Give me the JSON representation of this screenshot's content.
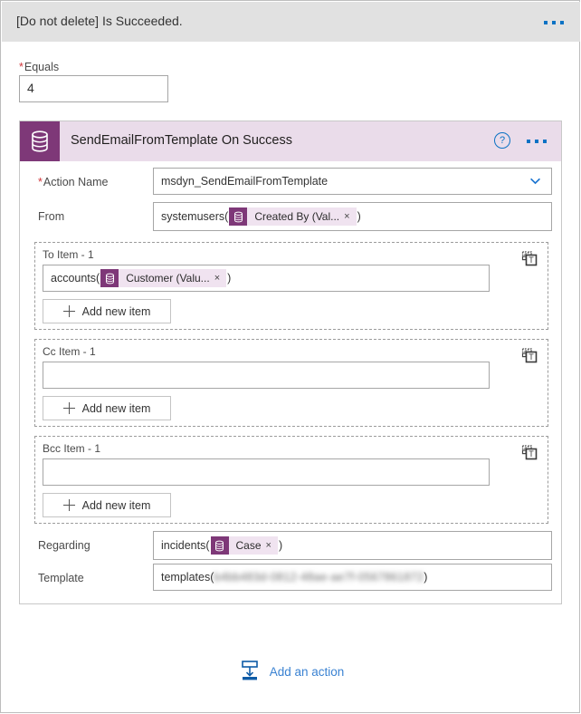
{
  "titlebar": {
    "title": "[Do not delete] Is Succeeded.",
    "more_menu": "…"
  },
  "condition": {
    "equals_label": "Equals",
    "equals_required": "*",
    "equals_value": "4"
  },
  "card": {
    "icon": "database-icon",
    "title": "SendEmailFromTemplate On Success",
    "help_icon": "?",
    "more_menu": "…",
    "action_name": {
      "label": "Action Name",
      "required": "*",
      "value": "msdyn_SendEmailFromTemplate",
      "chevron": "chevron-down-icon"
    },
    "from": {
      "label": "From",
      "prefix": "systemusers(",
      "chip_text": "Created By (Val...",
      "chip_close": "×",
      "suffix": ")"
    },
    "to_group": {
      "label": "To Item - 1",
      "prefix": "accounts(",
      "chip_text": "Customer (Valu...",
      "chip_close": "×",
      "suffix": ")",
      "add_new": "Add new item",
      "delete_icon": "delete-item-icon"
    },
    "cc_group": {
      "label": "Cc Item - 1",
      "value": "",
      "add_new": "Add new item",
      "delete_icon": "delete-item-icon"
    },
    "bcc_group": {
      "label": "Bcc Item - 1",
      "value": "",
      "add_new": "Add new item",
      "delete_icon": "delete-item-icon"
    },
    "regarding": {
      "label": "Regarding",
      "prefix": "incidents(",
      "chip_text": "Case",
      "chip_close": "×",
      "suffix": ")"
    },
    "template": {
      "label": "Template",
      "prefix": "templates(",
      "value_redacted": "b4bb483d-0812-48ae-ae7f-0567861872",
      "suffix": ")"
    }
  },
  "footer": {
    "add_action_label": "Add an action",
    "add_action_icon": "add-action-icon"
  },
  "colors": {
    "accent_purple": "#7e3878",
    "chip_bg": "#f0e3f0",
    "header_bg": "#eadcea",
    "link_blue": "#3a82d2",
    "titlebar_bg": "#e1e1e1",
    "required_red": "#d13438"
  }
}
